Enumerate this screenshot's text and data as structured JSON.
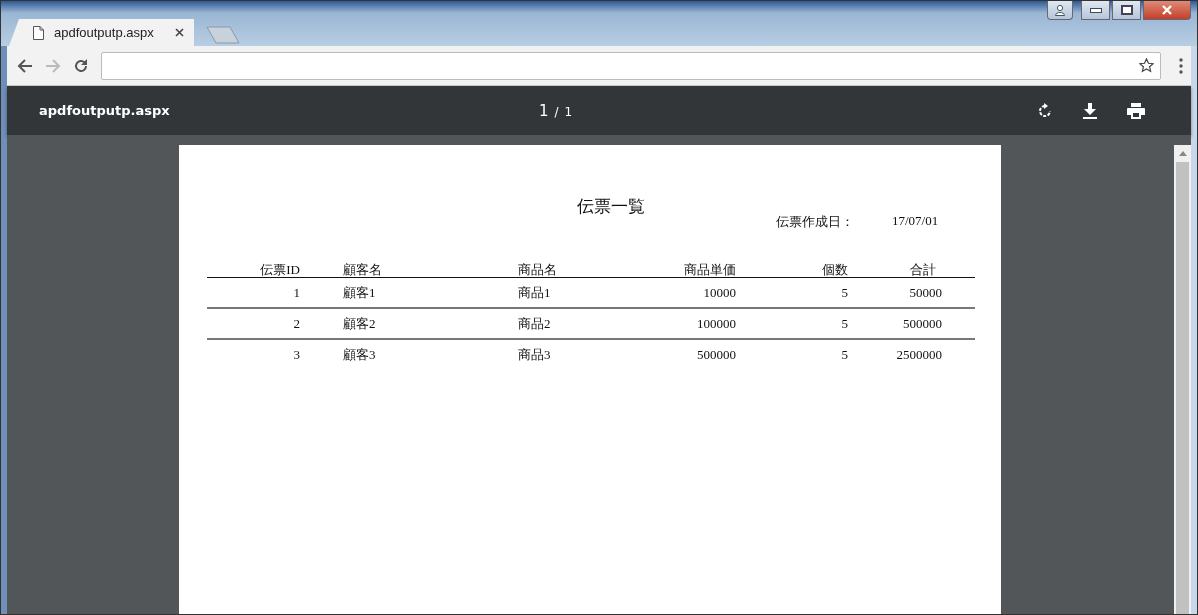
{
  "tabs": [
    {
      "title": "apdfoutputp.aspx",
      "selected": true
    }
  ],
  "nav_buttons": [
    {
      "kind": "back",
      "disabled": false
    },
    {
      "kind": "forward",
      "disabled": true
    },
    {
      "kind": "reload",
      "disabled": false
    }
  ],
  "pdf_viewer": {
    "file_name": "apdfoutputp.aspx",
    "current_page": "1",
    "page_separator": "/",
    "total_pages": "1",
    "tools": [
      {
        "kind": "rotate"
      },
      {
        "kind": "download"
      },
      {
        "kind": "print"
      }
    ]
  },
  "document": {
    "title": "伝票一覧",
    "date_label": "伝票作成日：",
    "date": "17/07/01",
    "columns": [
      "伝票ID",
      "顧客名",
      "商品名",
      "商品単価",
      "個数",
      "合計"
    ],
    "rows": [
      [
        "1",
        "顧客1",
        "商品1",
        "10000",
        "5",
        "50000"
      ],
      [
        "2",
        "顧客2",
        "商品2",
        "100000",
        "5",
        "500000"
      ],
      [
        "3",
        "顧客3",
        "商品3",
        "500000",
        "5",
        "2500000"
      ]
    ]
  }
}
